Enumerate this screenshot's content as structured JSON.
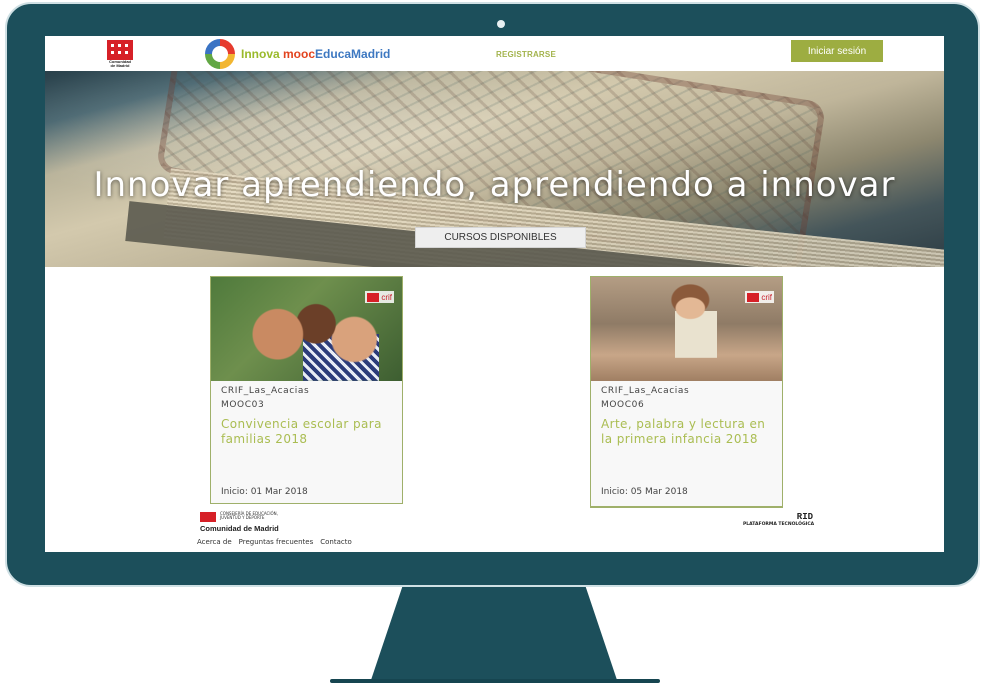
{
  "header": {
    "gov_logo_text": "Comunidad de Madrid",
    "brand": {
      "part1": "Innova ",
      "part2": "mooc",
      "part3": "EducaMadrid"
    },
    "register_label": "REGISTRARSE",
    "login_label": "Iniciar sesión"
  },
  "hero": {
    "title": "Innovar aprendiendo, aprendiendo a innovar",
    "button_label": "CURSOS DISPONIBLES"
  },
  "courses": [
    {
      "badge": "crif",
      "org": "CRIF_Las_Acacias",
      "code": "MOOC03",
      "title": "Convivencia escolar para familias 2018",
      "start": "Inicio: 01 Mar 2018"
    },
    {
      "badge": "crif",
      "org": "CRIF_Las_Acacias",
      "code": "MOOC06",
      "title": "Arte, palabra y lectura en la primera infancia 2018",
      "start": "Inicio: 05 Mar 2018"
    }
  ],
  "footer": {
    "consejeria": "CONSEJERÍA DE EDUCACIÓN, JUVENTUD Y DEPORTE",
    "cm_name": "Comunidad de Madrid",
    "links": [
      "Acerca de",
      "Preguntas frecuentes",
      "Contacto"
    ],
    "rid_logo": "RID",
    "rid_caption": "PLATAFORMA TECNOLÓGICA"
  },
  "colors": {
    "accent": "#9dad41",
    "monitor": "#1c4f5b",
    "title_green": "#aabd52",
    "brand_red": "#d62027"
  }
}
